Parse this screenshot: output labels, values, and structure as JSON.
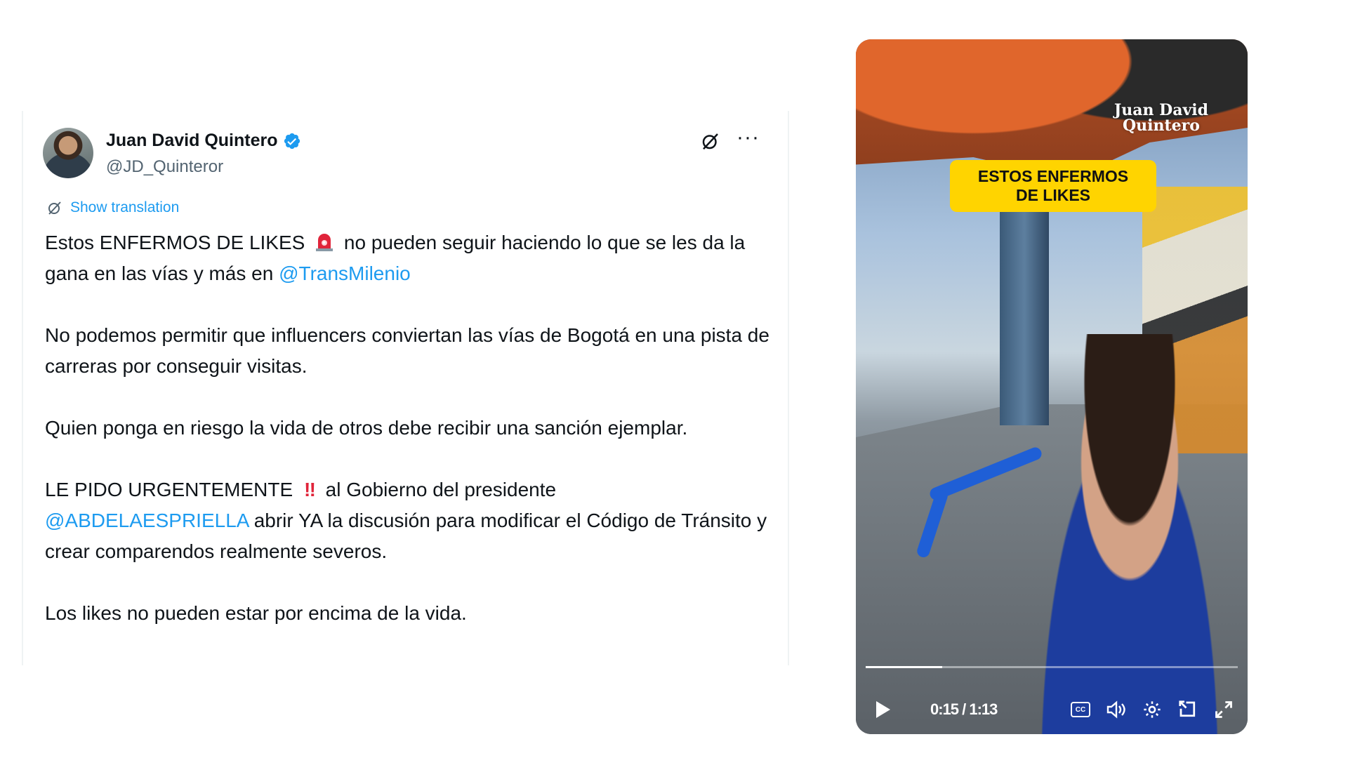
{
  "tweet": {
    "author": {
      "display_name": "Juan David Quintero",
      "handle": "@JD_Quinteror",
      "verified": true
    },
    "show_translation_label": "Show translation",
    "paragraphs": {
      "p1": {
        "text_a": "Estos ENFERMOS DE LIKES",
        "emoji": "rotating-light-emoji",
        "text_b": "no pueden seguir haciendo lo que se les da la gana en las vías y más en",
        "mention": "@TransMilenio"
      },
      "p2": "No podemos permitir que influencers conviertan las vías de Bogotá en una pista de carreras por conseguir visitas.",
      "p3": "Quien ponga en riesgo la vida de otros debe recibir una sanción ejemplar.",
      "p4": {
        "text_a": "LE PIDO URGENTEMENTE",
        "emoji": "‼",
        "text_b": "al Gobierno del presidente",
        "mention": "@ABDELAESPRIELLA",
        "text_c": "abrir YA la discusión para modificar el Código de Tránsito y crear comparendos realmente severos."
      },
      "p5": "Los likes no pueden estar por encima de la vida."
    },
    "colors": {
      "text": "#0f1419",
      "secondary": "#536471",
      "link": "#1d9bf0",
      "verified": "#1d9bf0"
    }
  },
  "video": {
    "caption": "ESTOS ENFERMOS\nDE LIKES",
    "watermark": "Juan David\nQuintero",
    "time": "0:15 / 1:13",
    "progress_fraction": 0.205,
    "controls": [
      "play-icon",
      "captions-icon",
      "volume-icon",
      "settings-icon",
      "picture-in-picture-icon",
      "fullscreen-icon"
    ],
    "colors": {
      "caption_bg": "#ffd400"
    }
  }
}
